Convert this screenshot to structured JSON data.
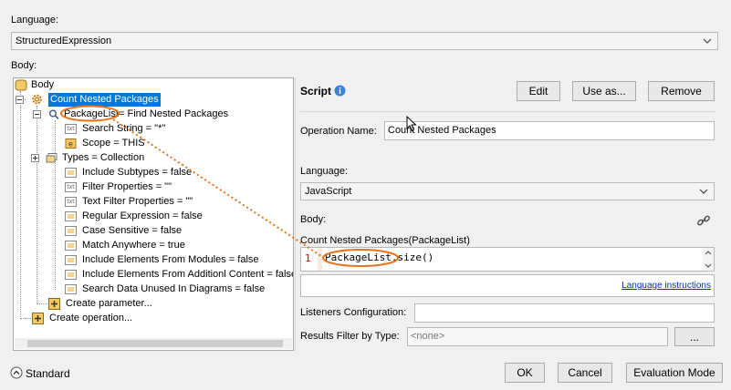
{
  "top": {
    "language_label": "Language:",
    "language_value": "StructuredExpression",
    "body_label": "Body:"
  },
  "tree": {
    "root": "Body",
    "op": "Count Nested Packages",
    "param": "PackageList",
    "param_suffix": " = Find Nested Packages",
    "items": [
      "Search String = \"*\"",
      "Scope = THIS",
      "Types = Collection",
      "Include Subtypes = false",
      "Filter Properties = \"\"",
      "Text Filter Properties = \"\"",
      "Regular Expression = false",
      "Case Sensitive = false",
      "Match Anywhere = true",
      "Include Elements From Modules = false",
      "Include Elements From Additionl Content = false",
      "Search Data Unused In Diagrams = false"
    ],
    "create_parameter": "Create parameter...",
    "create_operation": "Create operation..."
  },
  "script": {
    "title": "Script",
    "edit": "Edit",
    "use_as": "Use as...",
    "remove": "Remove",
    "op_name_label": "Operation Name:",
    "op_name_value": "Count Nested Packages",
    "language_label": "Language:",
    "language_value": "JavaScript",
    "body_label": "Body:",
    "signature": "Count Nested Packages(PackageList)",
    "line_no": "1",
    "code_ident": "PackageList",
    "code_rest": ".size()",
    "lang_instructions": "Language instructions",
    "listeners_label": "Listeners Configuration:",
    "results_label": "Results Filter by Type:",
    "results_placeholder": "<none>",
    "results_btn": "..."
  },
  "footer": {
    "standard": "Standard",
    "ok": "OK",
    "cancel": "Cancel",
    "evaluation": "Evaluation Mode"
  },
  "colors": {
    "selection": "#0078d7",
    "annotation": "#e8731a",
    "link": "#0033cc"
  }
}
